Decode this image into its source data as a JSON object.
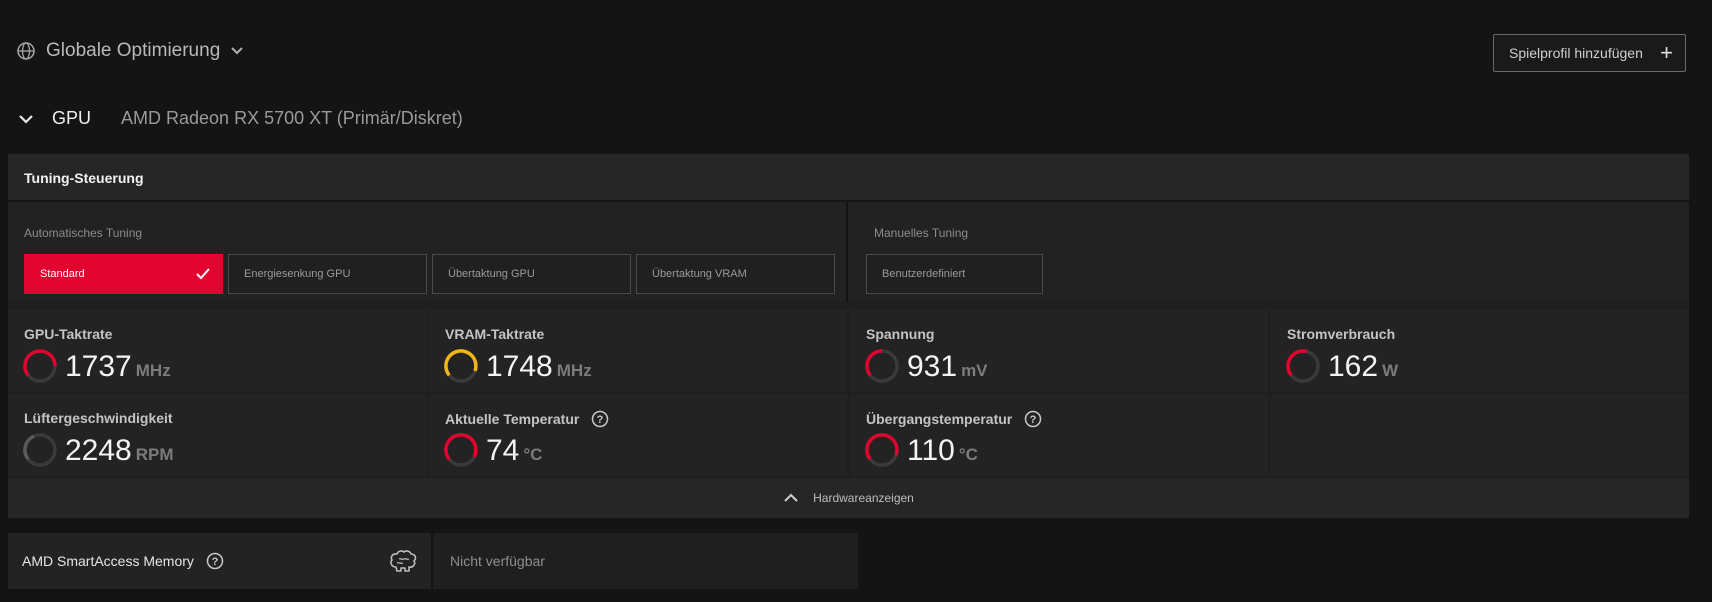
{
  "header": {
    "profile_title": "Globale Optimierung",
    "add_profile_label": "Spielprofil hinzufügen",
    "add_icon": "+"
  },
  "gpu": {
    "label": "GPU",
    "name": "AMD Radeon RX 5700 XT (Primär/Diskret)"
  },
  "panel": {
    "title": "Tuning-Steuerung",
    "auto_label": "Automatisches Tuning",
    "manual_label": "Manuelles Tuning",
    "auto_buttons": [
      {
        "label": "Standard",
        "active": true
      },
      {
        "label": "Energiesenkung GPU",
        "active": false
      },
      {
        "label": "Übertaktung GPU",
        "active": false
      },
      {
        "label": "Übertaktung VRAM",
        "active": false
      }
    ],
    "manual_buttons": [
      {
        "label": "Benutzerdefiniert",
        "active": false
      }
    ]
  },
  "metrics": [
    {
      "label": "GPU-Taktrate",
      "value": "1737",
      "unit": "MHz",
      "color": "#e0042e",
      "help": false
    },
    {
      "label": "VRAM-Taktrate",
      "value": "1748",
      "unit": "MHz",
      "color": "#f2b418",
      "help": false
    },
    {
      "label": "Spannung",
      "value": "931",
      "unit": "mV",
      "color": "#e0042e",
      "help": false
    },
    {
      "label": "Stromverbrauch",
      "value": "162",
      "unit": "W",
      "color": "#e0042e",
      "help": false
    },
    {
      "label": "Lüftergeschwindigkeit",
      "value": "2248",
      "unit": "RPM",
      "color": "#5a5a5a",
      "help": false
    },
    {
      "label": "Aktuelle Temperatur",
      "value": "74",
      "unit": "°C",
      "color": "#e0042e",
      "help": true
    },
    {
      "label": "Übergangstemperatur",
      "value": "110",
      "unit": "°C",
      "color": "#e0042e",
      "help": true
    }
  ],
  "hardware_toggle_label": "Hardwareanzeigen",
  "smart_access": {
    "label": "AMD SmartAccess Memory",
    "status": "Nicht verfügbar"
  },
  "colors": {
    "accent": "#e0042e",
    "vram_gauge": "#f2b418",
    "background": "#141414"
  }
}
